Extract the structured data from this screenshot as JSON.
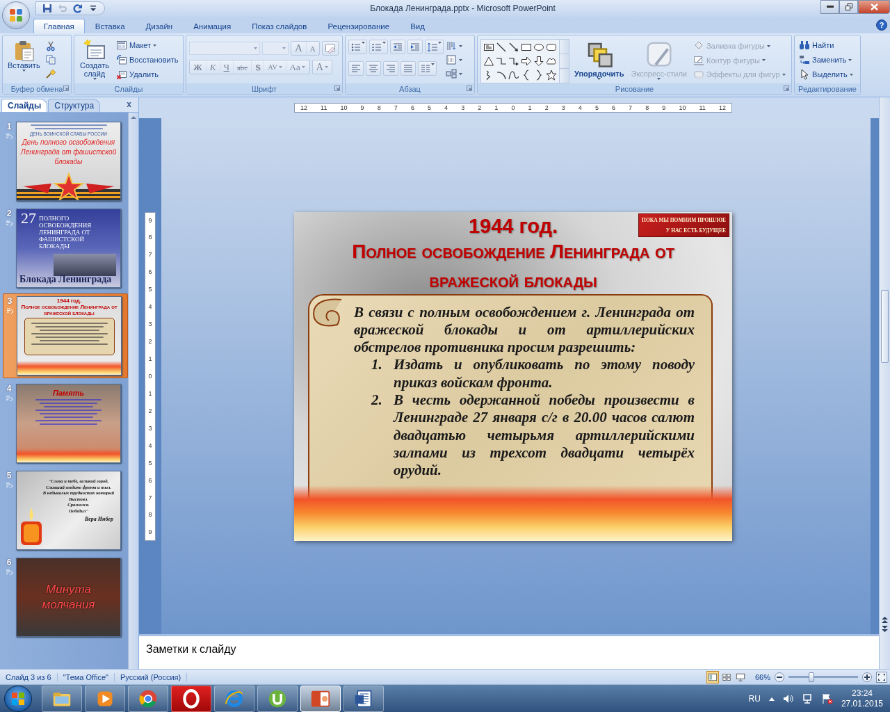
{
  "window": {
    "title": "Блокада Ленинграда.pptx - Microsoft PowerPoint"
  },
  "quick_access": [
    {
      "kind": "save",
      "disabled": false
    },
    {
      "kind": "undo",
      "disabled": true
    },
    {
      "kind": "redo",
      "disabled": false
    },
    {
      "kind": "customize",
      "disabled": false
    }
  ],
  "tabs": [
    {
      "label": "Главная",
      "selected": true
    },
    {
      "label": "Вставка",
      "selected": false
    },
    {
      "label": "Дизайн",
      "selected": false
    },
    {
      "label": "Анимация",
      "selected": false
    },
    {
      "label": "Показ слайдов",
      "selected": false
    },
    {
      "label": "Рецензирование",
      "selected": false
    },
    {
      "label": "Вид",
      "selected": false
    }
  ],
  "help": "?",
  "ribbon": {
    "clipboard": {
      "title": "Буфер обмена",
      "paste": "Вставить",
      "tools": [
        {
          "kind": "cut"
        },
        {
          "kind": "copy"
        },
        {
          "kind": "painter"
        }
      ]
    },
    "slides": {
      "title": "Слайды",
      "new_slide": "Создать слайд",
      "items": [
        {
          "kind": "layout",
          "label": "Макет",
          "dropdown": true
        },
        {
          "kind": "reset",
          "label": "Восстановить",
          "dropdown": false
        },
        {
          "kind": "delete",
          "label": "Удалить",
          "dropdown": false
        }
      ]
    },
    "font": {
      "title": "Шрифт",
      "disabled": true,
      "grow": "A",
      "shrink": "A",
      "format_buttons": [
        {
          "kind": "bold",
          "label": "Ж"
        },
        {
          "kind": "italic",
          "label": "К"
        },
        {
          "kind": "underline",
          "label": "Ч"
        },
        {
          "kind": "strike",
          "label": "abc"
        },
        {
          "kind": "shadow",
          "label": "S"
        },
        {
          "kind": "spacing",
          "label": "AV"
        },
        {
          "kind": "case",
          "label": "Aa"
        }
      ],
      "font_color_label": "A"
    },
    "paragraph": {
      "title": "Абзац",
      "row_1": [
        {
          "kind": "bullets"
        },
        {
          "kind": "numbering"
        },
        {
          "kind": "outdent"
        },
        {
          "kind": "indent"
        },
        {
          "kind": "spacing"
        }
      ],
      "row_2": [
        {
          "kind": "left"
        },
        {
          "kind": "center"
        },
        {
          "kind": "right"
        },
        {
          "kind": "justify"
        },
        {
          "kind": "columns"
        }
      ],
      "side": [
        {
          "kind": "text-direction"
        },
        {
          "kind": "align-text"
        },
        {
          "kind": "smartart"
        }
      ]
    },
    "drawing": {
      "title": "Рисование",
      "shapes": [
        {
          "kind": "textbox"
        },
        {
          "kind": "line"
        },
        {
          "kind": "arrow"
        },
        {
          "kind": "rect"
        },
        {
          "kind": "oval"
        },
        {
          "kind": "rounded"
        },
        {
          "kind": "triangle"
        },
        {
          "kind": "elbow"
        },
        {
          "kind": "elbow-arrow"
        },
        {
          "kind": "right-arrow"
        },
        {
          "kind": "down-arrow"
        },
        {
          "kind": "cloud"
        },
        {
          "kind": "freeform"
        },
        {
          "kind": "arc"
        },
        {
          "kind": "curve"
        },
        {
          "kind": "left-brace"
        },
        {
          "kind": "right-brace"
        },
        {
          "kind": "star"
        }
      ],
      "arrange": {
        "label": "Упорядочить",
        "disabled": false
      },
      "quick_styles": {
        "label": "Экспресс-стили",
        "disabled": true
      },
      "items": [
        {
          "kind": "fill",
          "label": "Заливка фигуры",
          "disabled": true
        },
        {
          "kind": "outline",
          "label": "Контур фигуры",
          "disabled": true
        },
        {
          "kind": "effects",
          "label": "Эффекты для фигур",
          "disabled": true
        }
      ]
    },
    "editing": {
      "title": "Редактирование",
      "items": [
        {
          "kind": "find",
          "label": "Найти",
          "dropdown": false
        },
        {
          "kind": "replace",
          "label": "Заменить",
          "dropdown": true
        },
        {
          "kind": "select",
          "label": "Выделить",
          "dropdown": true
        }
      ]
    }
  },
  "panel": {
    "tabs": [
      {
        "label": "Слайды",
        "selected": true
      },
      {
        "label": "Структура",
        "selected": false
      }
    ],
    "close": "x",
    "slides": [
      {
        "number": "1",
        "kind": "star",
        "selected": false,
        "heading": "ДЕНЬ ВОИНСКОЙ СЛАВЫ РОССИИ",
        "title": "День полного освобождения Ленинграда от фашистской блокады"
      },
      {
        "number": "2",
        "kind": "photo",
        "selected": false,
        "heading": "27",
        "title": "ПОЛНОГО ОСВОБОЖДЕНИЯ ЛЕНИНГРАДА ОТ ФАШИСТСКОЙ БЛОКАДЫ",
        "caption": "Блокада Ленинграда"
      },
      {
        "number": "3",
        "kind": "scroll",
        "selected": true,
        "heading": "1944 год.",
        "title": "Полное освобождение Ленинграда от вражеской блокады"
      },
      {
        "number": "4",
        "kind": "memory",
        "selected": false,
        "title": "Память"
      },
      {
        "number": "5",
        "kind": "candle",
        "selected": false,
        "lines": [
          "\"Слава и тебе, великий город,",
          "Сливший воедино фронт и тыл.",
          "В небывалых трудностях который",
          "Выстоял.",
          "Сражался.",
          "Победил\""
        ],
        "caption": "Вера Инбер"
      },
      {
        "number": "6",
        "kind": "flame",
        "selected": false,
        "title": "Минута молчания"
      }
    ]
  },
  "ruler": {
    "horizontal": [
      "12",
      "11",
      "10",
      "9",
      "8",
      "7",
      "6",
      "5",
      "4",
      "3",
      "2",
      "1",
      "0",
      "1",
      "2",
      "3",
      "4",
      "5",
      "6",
      "7",
      "8",
      "9",
      "10",
      "11",
      "12"
    ],
    "vertical": [
      "9",
      "8",
      "7",
      "6",
      "5",
      "4",
      "3",
      "2",
      "1",
      "0",
      "1",
      "2",
      "3",
      "4",
      "5",
      "6",
      "7",
      "8",
      "9"
    ]
  },
  "slide": {
    "year": "1944 год.",
    "title": "Полное освобождение Ленинграда от вражеской блокады",
    "logo_lines": [
      "ПОКА МЫ ПОМНИМ ПРОШЛОЕ",
      "У НАС ЕСТЬ БУДУЩЕЕ"
    ],
    "intro": "В связи с полным освобождением г. Ленинграда от вражеской блокады и от артиллерийских обстрелов противника просим разрешить:",
    "items": [
      {
        "number": "1.",
        "text": "Издать и опубликовать по этому поводу приказ войскам фронта."
      },
      {
        "number": "2.",
        "text": "В честь одержанной победы произвести в Ленинграде 27 января с/г в 20.00 часов салют двадцатью четырьмя артиллерийскими залпами из трехсот двадцати четырёх орудий."
      }
    ]
  },
  "notes": {
    "placeholder": "Заметки к слайду"
  },
  "status_bar": {
    "slide": "Слайд 3 из 6",
    "theme": "\"Тема Office\"",
    "language": "Русский (Россия)",
    "views": [
      {
        "kind": "normal",
        "selected": true
      },
      {
        "kind": "sorter",
        "selected": false
      },
      {
        "kind": "show",
        "selected": false
      }
    ],
    "zoom": "66%",
    "zoom_slider": {
      "level": 0.33
    }
  },
  "taskbar": {
    "apps": [
      {
        "kind": "explorer",
        "selected": false
      },
      {
        "kind": "media",
        "selected": false
      },
      {
        "kind": "chrome",
        "selected": false
      },
      {
        "kind": "opera",
        "selected": false
      },
      {
        "kind": "ie",
        "selected": false
      },
      {
        "kind": "torrent",
        "selected": false
      },
      {
        "kind": "powerpoint",
        "selected": true
      },
      {
        "kind": "word",
        "selected": false
      }
    ],
    "language": "RU",
    "time": "23:24",
    "date": "27.01.2015"
  }
}
